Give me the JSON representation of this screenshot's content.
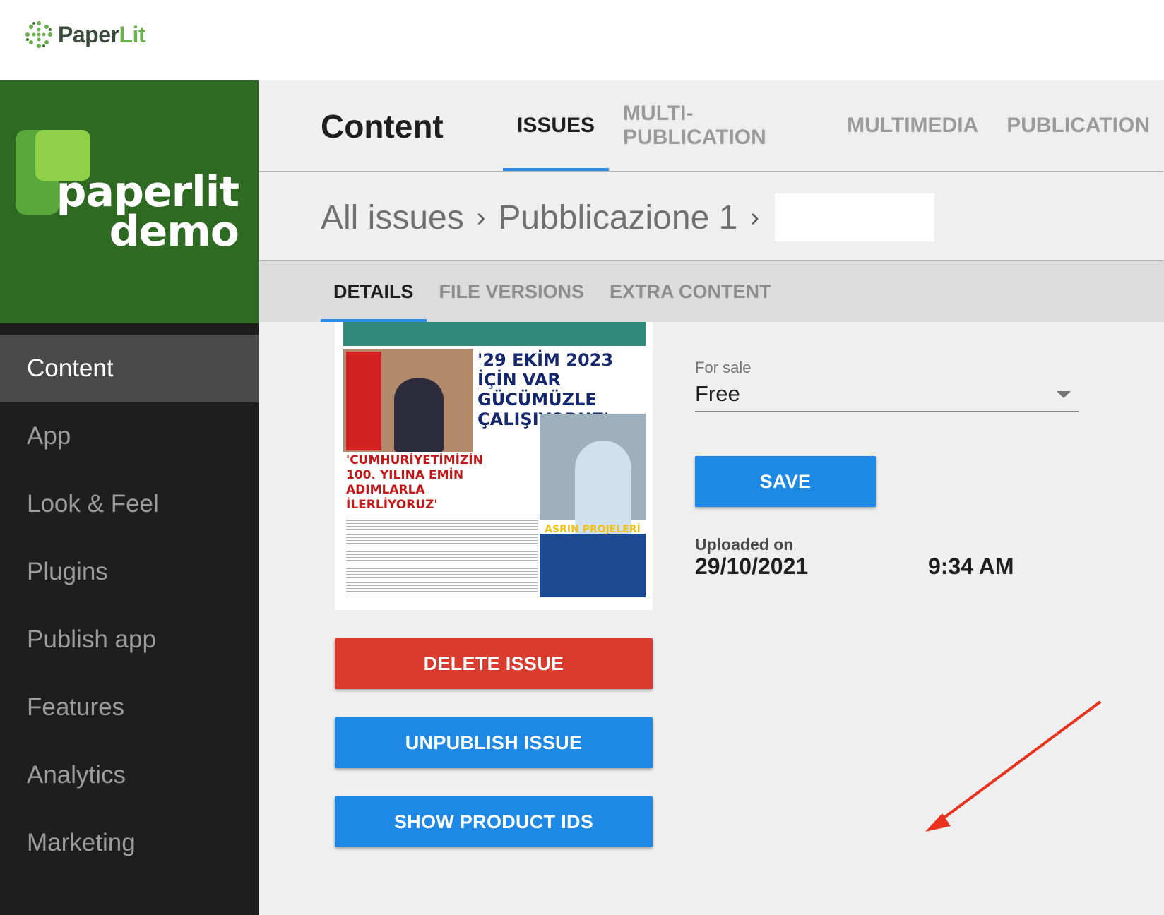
{
  "topbar": {
    "brand_paper": "Paper",
    "brand_lit": "Lit"
  },
  "sidebar": {
    "logo_line1": "paperlit",
    "logo_line2": "demo",
    "items": [
      {
        "label": "Content",
        "active": true
      },
      {
        "label": "App"
      },
      {
        "label": "Look & Feel"
      },
      {
        "label": "Plugins"
      },
      {
        "label": "Publish app"
      },
      {
        "label": "Features"
      },
      {
        "label": "Analytics"
      },
      {
        "label": "Marketing"
      }
    ]
  },
  "header": {
    "title": "Content",
    "tabs": [
      {
        "label": "ISSUES",
        "active": true
      },
      {
        "label": "MULTI-PUBLICATION"
      },
      {
        "label": "MULTIMEDIA"
      },
      {
        "label": "PUBLICATION"
      }
    ]
  },
  "breadcrumb": {
    "items": [
      "All issues",
      "Pubblicazione 1"
    ],
    "separator": "›"
  },
  "subtabs": [
    {
      "label": "DETAILS",
      "active": true
    },
    {
      "label": "FILE VERSIONS"
    },
    {
      "label": "EXTRA CONTENT"
    }
  ],
  "cover": {
    "headline": "'29 EKİM 2023 İÇİN VAR GÜCÜMÜZLE ÇALIŞIYORUZ'",
    "red_headline": "'CUMHURİYETİMİZİN 100. YILINA EMİN ADIMLARLA İLERLİYORUZ'",
    "blue_title": "ASRIN PROJELERİ"
  },
  "form": {
    "for_sale_label": "For sale",
    "for_sale_value": "Free",
    "save_label": "SAVE",
    "uploaded_label": "Uploaded on",
    "uploaded_date": "29/10/2021",
    "uploaded_time": "9:34 AM"
  },
  "actions": {
    "delete_label": "DELETE ISSUE",
    "unpublish_label": "UNPUBLISH ISSUE",
    "show_ids_label": "SHOW PRODUCT IDS"
  },
  "colors": {
    "accent": "#1e88e5",
    "danger": "#d93b2f",
    "sidebar_logo_bg": "#2f6a22",
    "sidebar_bg": "#1e1e1e",
    "annotation_arrow": "#e8321e"
  }
}
